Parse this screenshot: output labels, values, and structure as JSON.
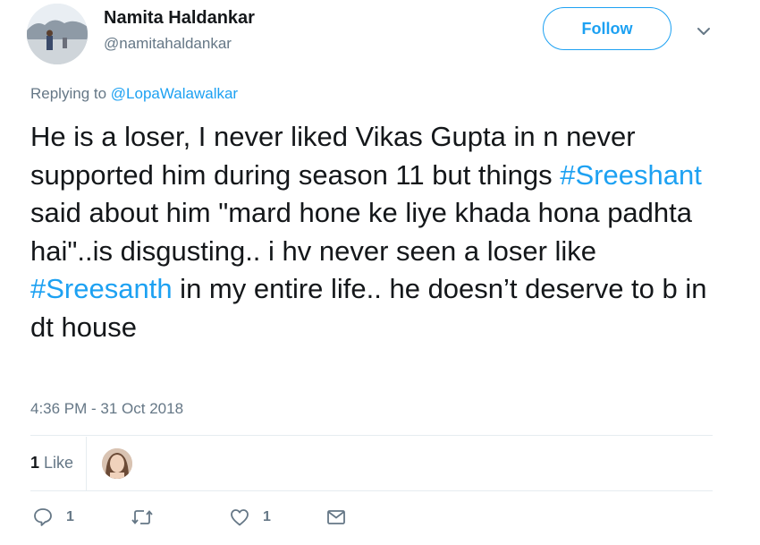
{
  "user": {
    "name": "Namita Haldankar",
    "handle": "@namitahaldankar"
  },
  "follow_label": "Follow",
  "reply_context": {
    "prefix": "Replying to",
    "mention": "@LopaWalawalkar"
  },
  "tweet": {
    "seg1": "He is a loser, I never liked Vikas Gupta in n never supported him during season 11 but things ",
    "hashtag1": "#Sreeshant",
    "seg2": " said about him \"mard hone ke liye khada hona padhta hai\"..is disgusting.. i hv never seen a loser like ",
    "hashtag2": "#Sreesanth",
    "seg3": " in my entire life.. he doesn’t deserve to b in dt house"
  },
  "timestamp": "4:36 PM - 31 Oct 2018",
  "likes": {
    "count": "1",
    "label": "Like"
  },
  "actions": {
    "reply_count": "1",
    "like_count": "1"
  },
  "icons": {
    "caret": "chevron-down-icon",
    "reply": "reply-icon",
    "retweet": "retweet-icon",
    "like": "heart-icon",
    "message": "envelope-icon"
  },
  "colors": {
    "accent": "#1da1f2",
    "secondary_text": "#657786",
    "primary_text": "#14171a",
    "divider": "#e6ecf0"
  }
}
